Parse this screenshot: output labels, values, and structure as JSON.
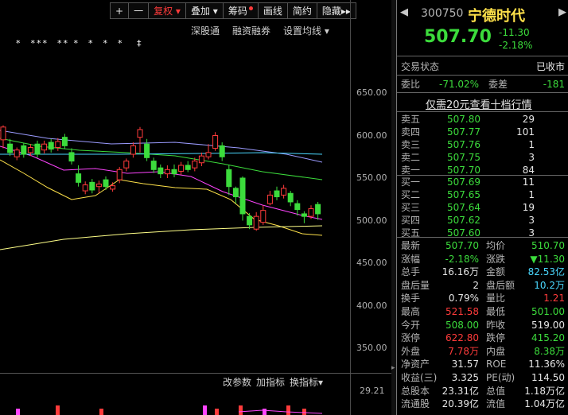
{
  "toolbar": {
    "plus": "+",
    "minus": "一",
    "fuquan": "复权",
    "fuquan_arrow": "▾",
    "diejia": "叠加",
    "diejia_arrow": "▾",
    "chouma": "筹码",
    "huaxian": "画线",
    "jianyue": "简约",
    "yincang": "隐藏",
    "more": "▸▸"
  },
  "subbar": {
    "shengutong": "深股通",
    "rongzi": "融资融券",
    "junxian": "设置均线",
    "junxian_arrow": "▾"
  },
  "markers": "*  ***  ** *  *  *  *   ‡",
  "y_ticks": [
    "650.00",
    "600.00",
    "550.00",
    "500.00",
    "450.00",
    "400.00",
    "350.00"
  ],
  "indicator_bar": {
    "params": "改参数",
    "add": "加指标",
    "swap": "换指标",
    "arrow": "▾"
  },
  "indicator_value": "29.21",
  "colors": {
    "up": "#ff3b3b",
    "down": "#3cdc3c",
    "ma5": "#e6e6e6",
    "ma10": "#ffe24a",
    "ma20": "#ff44ff",
    "ma60": "#3cdc3c",
    "ma120": "#9b9bff",
    "ma250": "#ffff88"
  },
  "header": {
    "arrow_left": "◀",
    "code": "300750",
    "name": "宁德时代",
    "arrow_right": "▶",
    "price": "507.70",
    "change": "-11.30",
    "pct": "-2.18%"
  },
  "status": {
    "label": "交易状态",
    "value": "已收市"
  },
  "weibi": {
    "label": "委比",
    "value": "-71.02%",
    "label2": "委差",
    "value2": "-181"
  },
  "promo": "仅需20元查看十档行情",
  "sells": [
    {
      "label": "卖五",
      "price": "507.80",
      "vol": "29"
    },
    {
      "label": "卖四",
      "price": "507.77",
      "vol": "101"
    },
    {
      "label": "卖三",
      "price": "507.76",
      "vol": "1"
    },
    {
      "label": "卖二",
      "price": "507.75",
      "vol": "3"
    },
    {
      "label": "卖一",
      "price": "507.70",
      "vol": "84"
    }
  ],
  "buys": [
    {
      "label": "买一",
      "price": "507.69",
      "vol": "11"
    },
    {
      "label": "买二",
      "price": "507.65",
      "vol": "1"
    },
    {
      "label": "买三",
      "price": "507.64",
      "vol": "19"
    },
    {
      "label": "买四",
      "price": "507.62",
      "vol": "3"
    },
    {
      "label": "买五",
      "price": "507.60",
      "vol": "3"
    }
  ],
  "stats": [
    {
      "l1": "最新",
      "v1": "507.70",
      "c1": "green",
      "l2": "均价",
      "v2": "510.70",
      "c2": "green"
    },
    {
      "l1": "涨幅",
      "v1": "-2.18%",
      "c1": "green",
      "l2": "涨跌",
      "v2": "▼11.30",
      "c2": "green"
    },
    {
      "l1": "总手",
      "v1": "16.16万",
      "c1": "white",
      "l2": "金额",
      "v2": "82.53亿",
      "c2": "cyan"
    },
    {
      "l1": "盘后量",
      "v1": "2",
      "c1": "white",
      "l2": "盘后额",
      "v2": "10.2万",
      "c2": "cyan"
    },
    {
      "l1": "换手",
      "v1": "0.79%",
      "c1": "white",
      "l2": "量比",
      "v2": "1.21",
      "c2": "red"
    },
    {
      "l1": "最高",
      "v1": "521.58",
      "c1": "red",
      "l2": "最低",
      "v2": "501.00",
      "c2": "green"
    },
    {
      "l1": "今开",
      "v1": "508.00",
      "c1": "green",
      "l2": "昨收",
      "v2": "519.00",
      "c2": "white"
    },
    {
      "l1": "涨停",
      "v1": "622.80",
      "c1": "red",
      "l2": "跌停",
      "v2": "415.20",
      "c2": "green"
    },
    {
      "l1": "外盘",
      "v1": "7.78万",
      "c1": "red",
      "l2": "内盘",
      "v2": "8.38万",
      "c2": "green"
    },
    {
      "l1": "净资产",
      "v1": "31.57",
      "c1": "white",
      "l2": "ROE",
      "v2": "11.36%",
      "c2": "white"
    },
    {
      "l1": "收益(三)",
      "v1": "3.325",
      "c1": "white",
      "l2": "PE(动)",
      "v2": "114.50",
      "c2": "white"
    },
    {
      "l1": "总股本",
      "v1": "23.31亿",
      "c1": "white",
      "l2": "总值",
      "v2": "1.18万亿",
      "c2": "white"
    },
    {
      "l1": "流通股",
      "v1": "20.39亿",
      "c1": "white",
      "l2": "流值",
      "v2": "1.04万亿",
      "c2": "white"
    }
  ],
  "candles": [
    {
      "o": 595,
      "c": 610,
      "h": 612,
      "l": 585
    },
    {
      "o": 590,
      "c": 580,
      "h": 596,
      "l": 576
    },
    {
      "o": 575,
      "c": 583,
      "h": 586,
      "l": 571
    },
    {
      "o": 588,
      "c": 578,
      "h": 591,
      "l": 574
    },
    {
      "o": 580,
      "c": 586,
      "h": 590,
      "l": 576
    },
    {
      "o": 590,
      "c": 578,
      "h": 594,
      "l": 574
    },
    {
      "o": 583,
      "c": 590,
      "h": 594,
      "l": 579
    },
    {
      "o": 592,
      "c": 584,
      "h": 596,
      "l": 580
    },
    {
      "o": 586,
      "c": 593,
      "h": 597,
      "l": 582
    },
    {
      "o": 598,
      "c": 588,
      "h": 602,
      "l": 584
    },
    {
      "o": 580,
      "c": 570,
      "h": 585,
      "l": 566
    },
    {
      "o": 555,
      "c": 545,
      "h": 565,
      "l": 540
    },
    {
      "o": 535,
      "c": 542,
      "h": 546,
      "l": 531
    },
    {
      "o": 545,
      "c": 536,
      "h": 549,
      "l": 532
    },
    {
      "o": 540,
      "c": 543,
      "h": 547,
      "l": 532
    },
    {
      "o": 548,
      "c": 540,
      "h": 552,
      "l": 536
    },
    {
      "o": 537,
      "c": 541,
      "h": 545,
      "l": 534
    },
    {
      "o": 548,
      "c": 560,
      "h": 563,
      "l": 544
    },
    {
      "o": 562,
      "c": 570,
      "h": 573,
      "l": 558
    },
    {
      "o": 578,
      "c": 588,
      "h": 592,
      "l": 574
    },
    {
      "o": 598,
      "c": 607,
      "h": 610,
      "l": 580
    },
    {
      "o": 590,
      "c": 574,
      "h": 596,
      "l": 570
    },
    {
      "o": 570,
      "c": 560,
      "h": 574,
      "l": 556
    },
    {
      "o": 562,
      "c": 555,
      "h": 566,
      "l": 550
    },
    {
      "o": 555,
      "c": 560,
      "h": 565,
      "l": 550
    },
    {
      "o": 560,
      "c": 555,
      "h": 566,
      "l": 551
    },
    {
      "o": 558,
      "c": 565,
      "h": 569,
      "l": 554
    },
    {
      "o": 565,
      "c": 560,
      "h": 570,
      "l": 557
    },
    {
      "o": 562,
      "c": 570,
      "h": 574,
      "l": 558
    },
    {
      "o": 568,
      "c": 576,
      "h": 580,
      "l": 564
    },
    {
      "o": 575,
      "c": 580,
      "h": 590,
      "l": 572
    },
    {
      "o": 585,
      "c": 600,
      "h": 604,
      "l": 582
    },
    {
      "o": 588,
      "c": 575,
      "h": 592,
      "l": 570
    },
    {
      "o": 560,
      "c": 540,
      "h": 565,
      "l": 530
    },
    {
      "o": 538,
      "c": 528,
      "h": 540,
      "l": 520
    },
    {
      "o": 550,
      "c": 508,
      "h": 552,
      "l": 500
    },
    {
      "o": 505,
      "c": 495,
      "h": 509,
      "l": 490
    },
    {
      "o": 490,
      "c": 505,
      "h": 510,
      "l": 488
    },
    {
      "o": 498,
      "c": 512,
      "h": 518,
      "l": 495
    },
    {
      "o": 520,
      "c": 530,
      "h": 535,
      "l": 518
    },
    {
      "o": 535,
      "c": 528,
      "h": 540,
      "l": 524
    },
    {
      "o": 530,
      "c": 538,
      "h": 542,
      "l": 526
    },
    {
      "o": 532,
      "c": 522,
      "h": 535,
      "l": 517
    },
    {
      "o": 520,
      "c": 513,
      "h": 524,
      "l": 506
    },
    {
      "o": 508,
      "c": 505,
      "h": 511,
      "l": 497
    },
    {
      "o": 505,
      "c": 514,
      "h": 518,
      "l": 502
    },
    {
      "o": 519,
      "c": 508,
      "h": 522,
      "l": 501
    }
  ]
}
